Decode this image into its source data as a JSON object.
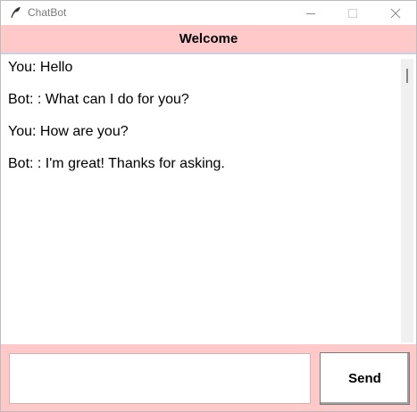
{
  "window": {
    "title": "ChatBot",
    "icon": "feather-icon"
  },
  "header": {
    "title": "Welcome"
  },
  "chat": {
    "messages": [
      "You: Hello",
      "Bot: : What can I do for you?",
      "You: How are you?",
      "Bot: : I'm great! Thanks for asking."
    ]
  },
  "input": {
    "value": "",
    "placeholder": ""
  },
  "send_button": {
    "label": "Send"
  },
  "colors": {
    "accent": "#ffc9c9",
    "background": "#ffffff"
  }
}
